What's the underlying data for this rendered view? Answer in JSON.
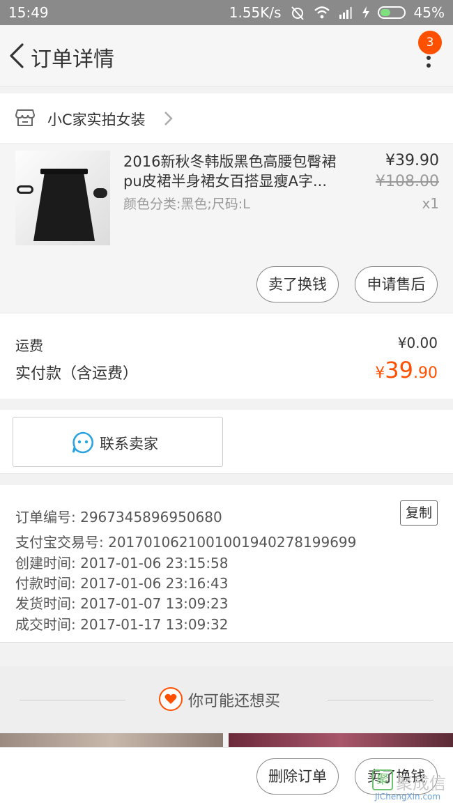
{
  "status_bar": {
    "time": "15:49",
    "speed": "1.55K/s",
    "battery": "45%",
    "battery_level": 0.45
  },
  "nav": {
    "title": "订单详情",
    "badge": "3"
  },
  "shop": {
    "name": "小C家实拍女装"
  },
  "product": {
    "title_line1": "2016新秋冬韩版黑色高腰包臀裙",
    "title_line2": "pu皮裙半身裙女百搭显瘦A字...",
    "spec": "颜色分类:黑色;尺码:L",
    "price": "¥39.90",
    "original_price": "¥108.00",
    "quantity": "x1",
    "actions": {
      "sell": "卖了换钱",
      "after_sale": "申请售后"
    }
  },
  "fees": {
    "shipping_label": "运费",
    "shipping_value": "¥0.00",
    "paid_label": "实付款（含运费）",
    "paid_currency": "¥",
    "paid_int": "39",
    "paid_dec": ".90"
  },
  "contact": {
    "label": "联系卖家"
  },
  "order_info": {
    "order_no": "订单编号: 2967345896950680",
    "alipay_no": "支付宝交易号: 2017010621001001940278199699",
    "created": "创建时间: 2017-01-06 23:15:58",
    "paid": "付款时间: 2017-01-06 23:16:43",
    "shipped": "发货时间: 2017-01-07 13:09:23",
    "completed": "成交时间: 2017-01-17 13:09:32",
    "copy_label": "复制"
  },
  "recommend": {
    "title": "你可能还想买"
  },
  "bottom_bar": {
    "delete_label": "删除订单",
    "sell_label": "卖了换钱"
  },
  "watermark": {
    "big": "聚成信",
    "small": "JiChengXin.com"
  },
  "colors": {
    "accent": "#ff5000",
    "contact_icon": "#29a3e0",
    "battery": "#7fe07f"
  }
}
